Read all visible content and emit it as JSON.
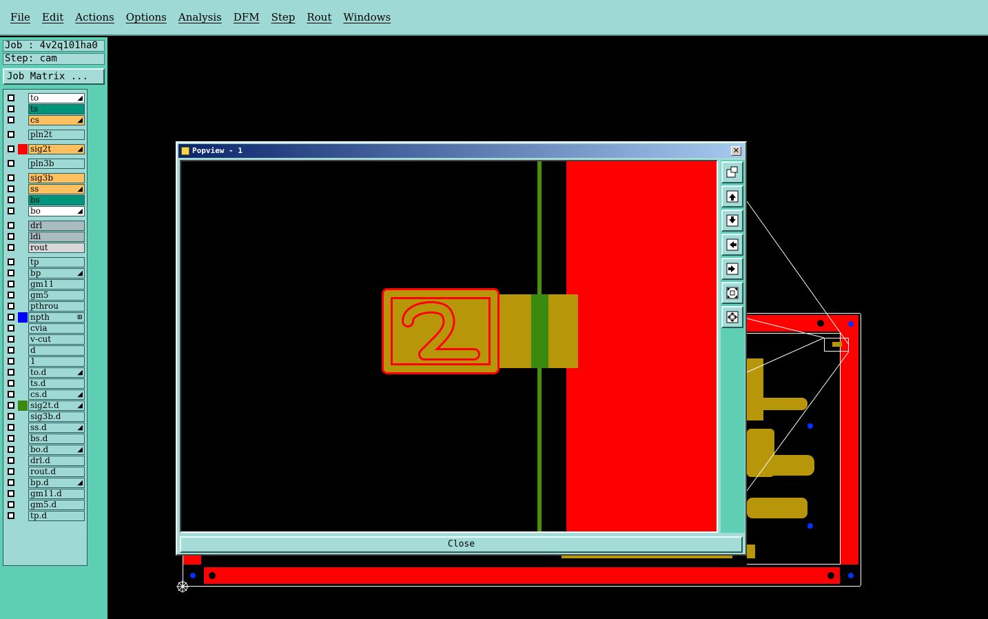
{
  "menu": [
    "File",
    "Edit",
    "Actions",
    "Options",
    "Analysis",
    "DFM",
    "Step",
    "Rout",
    "Windows"
  ],
  "job": {
    "job_label": "Job : 4v2q101ha0",
    "step_label": "Step: cam",
    "job_matrix": "Job Matrix ..."
  },
  "layers": [
    {
      "name": "to",
      "bg": "#ffffff",
      "color": "",
      "mark": "◢"
    },
    {
      "name": "ts",
      "bg": "#00957a",
      "color": "",
      "mark": ""
    },
    {
      "name": "cs",
      "bg": "#ffc060",
      "color": "",
      "mark": "◢"
    },
    {
      "name": "pln2t",
      "bg": "#9fd9d6",
      "color": "",
      "mark": ""
    },
    {
      "name": "sig2t",
      "bg": "#ffc060",
      "color": "#ff0000",
      "mark": "◢"
    },
    {
      "name": "pln3b",
      "bg": "#9fd9d6",
      "color": "",
      "mark": ""
    },
    {
      "name": "sig3b",
      "bg": "#ffc060",
      "color": "",
      "mark": ""
    },
    {
      "name": "ss",
      "bg": "#ffc060",
      "color": "",
      "mark": "◢"
    },
    {
      "name": "bs",
      "bg": "#00957a",
      "color": "",
      "mark": ""
    },
    {
      "name": "bo",
      "bg": "#ffffff",
      "color": "",
      "mark": "◢"
    },
    {
      "name": "drl",
      "bg": "#a9bcc0",
      "color": "",
      "mark": ""
    },
    {
      "name": "ldi",
      "bg": "#a9bcc0",
      "color": "",
      "mark": ""
    },
    {
      "name": "rout",
      "bg": "#d8d8d8",
      "color": "",
      "mark": ""
    },
    {
      "name": "tp",
      "bg": "#9fd9d6",
      "color": "",
      "mark": ""
    },
    {
      "name": "bp",
      "bg": "#9fd9d6",
      "color": "",
      "mark": "◢"
    },
    {
      "name": "gm11",
      "bg": "#9fd9d6",
      "color": "",
      "mark": ""
    },
    {
      "name": "gm5",
      "bg": "#9fd9d6",
      "color": "",
      "mark": ""
    },
    {
      "name": "pthrou",
      "bg": "#9fd9d6",
      "color": "",
      "mark": ""
    },
    {
      "name": "npth",
      "bg": "#9fd9d6",
      "color": "#0000ff",
      "mark": "⊞"
    },
    {
      "name": "cvia",
      "bg": "#9fd9d6",
      "color": "",
      "mark": ""
    },
    {
      "name": "v-cut",
      "bg": "#9fd9d6",
      "color": "",
      "mark": ""
    },
    {
      "name": "d",
      "bg": "#9fd9d6",
      "color": "",
      "mark": ""
    },
    {
      "name": "1",
      "bg": "#9fd9d6",
      "color": "",
      "mark": ""
    },
    {
      "name": "to.d",
      "bg": "#9fd9d6",
      "color": "",
      "mark": "◢"
    },
    {
      "name": "ts.d",
      "bg": "#9fd9d6",
      "color": "",
      "mark": ""
    },
    {
      "name": "cs.d",
      "bg": "#9fd9d6",
      "color": "",
      "mark": "◢"
    },
    {
      "name": "sig2t.d",
      "bg": "#9fd9d6",
      "color": "#3a8a10",
      "mark": "◢"
    },
    {
      "name": "sig3b.d",
      "bg": "#9fd9d6",
      "color": "",
      "mark": ""
    },
    {
      "name": "ss.d",
      "bg": "#9fd9d6",
      "color": "",
      "mark": "◢"
    },
    {
      "name": "bs.d",
      "bg": "#9fd9d6",
      "color": "",
      "mark": ""
    },
    {
      "name": "bo.d",
      "bg": "#9fd9d6",
      "color": "",
      "mark": "◢"
    },
    {
      "name": "drl.d",
      "bg": "#9fd9d6",
      "color": "",
      "mark": ""
    },
    {
      "name": "rout.d",
      "bg": "#9fd9d6",
      "color": "",
      "mark": ""
    },
    {
      "name": "bp.d",
      "bg": "#9fd9d6",
      "color": "",
      "mark": "◢"
    },
    {
      "name": "gm11.d",
      "bg": "#9fd9d6",
      "color": "",
      "mark": ""
    },
    {
      "name": "gm5.d",
      "bg": "#9fd9d6",
      "color": "",
      "mark": ""
    },
    {
      "name": "tp.d",
      "bg": "#9fd9d6",
      "color": "",
      "mark": ""
    }
  ],
  "popview": {
    "title": "Popview - 1",
    "close_label": "Close",
    "close_x": "✕",
    "canvas_glyph": "2",
    "toolbar_icons": [
      "zoom-window-icon",
      "pan-up-icon",
      "pan-down-icon",
      "pan-left-icon",
      "pan-right-icon",
      "zoom-fit-icon",
      "zoom-home-icon"
    ]
  },
  "colors": {
    "panel": "#9fd9d6",
    "accent": "#5fcfb4",
    "copper": "#b8960a",
    "plane": "#ff0000",
    "trace": "#3a8a10"
  }
}
